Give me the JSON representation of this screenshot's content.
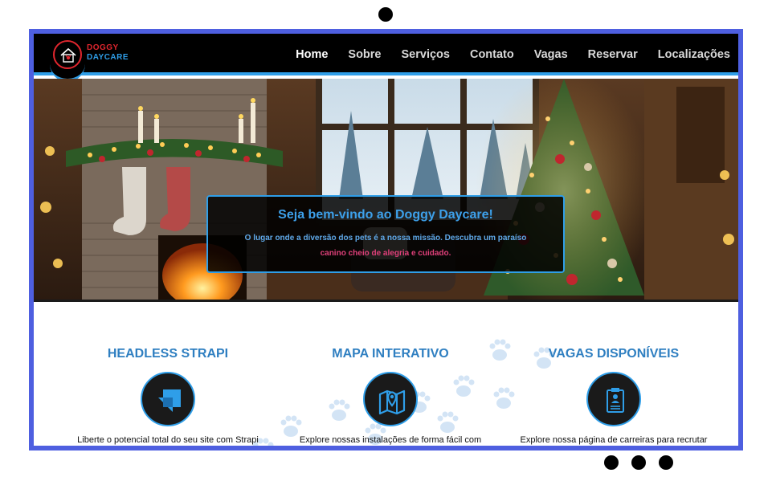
{
  "window": {
    "indicator_colors": {
      "frame": "#4e5fe0",
      "accent": "#2f9ee8",
      "brand_red": "#e0262e"
    }
  },
  "brand": {
    "line1": "DOGGY",
    "line2": "DAYCARE",
    "logo_icon": "dog-house-icon"
  },
  "nav": {
    "items": [
      {
        "label": "Home",
        "active": true
      },
      {
        "label": "Sobre",
        "active": false
      },
      {
        "label": "Serviços",
        "active": false
      },
      {
        "label": "Contato",
        "active": false
      },
      {
        "label": "Vagas",
        "active": false
      },
      {
        "label": "Reservar",
        "active": false
      },
      {
        "label": "Localizações",
        "active": false
      }
    ]
  },
  "hero": {
    "image_icon": "christmas-living-room-image",
    "title": "Seja bem-vindo ao Doggy Daycare!",
    "text_part1": "O lugar onde a diversão dos pets é a nossa missão. Descubra um paraíso",
    "text_part2": "canino cheio de alegria e cuidado."
  },
  "features": [
    {
      "title": "HEADLESS STRAPI",
      "icon": "strapi-logo-icon",
      "text": "Liberte o potencial total do seu site com Strapi"
    },
    {
      "title": "MAPA INTERATIVO",
      "icon": "map-pin-icon",
      "text": "Explore nossas instalações de forma fácil com"
    },
    {
      "title": "VAGAS DISPONÍVEIS",
      "icon": "resume-document-icon",
      "text": "Explore nossa página de carreiras para recrutar"
    }
  ]
}
